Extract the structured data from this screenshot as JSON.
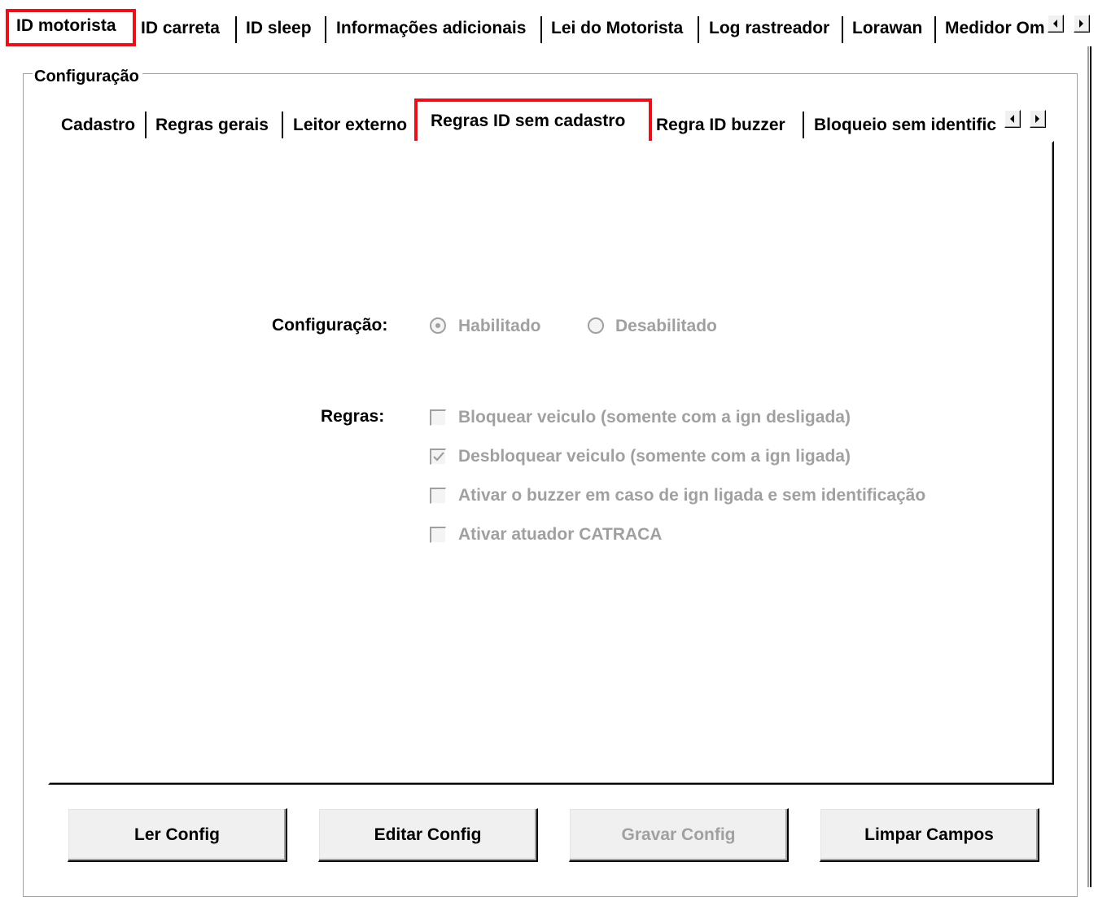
{
  "top_tabs": [
    {
      "label": "ID motorista"
    },
    {
      "label": "ID carreta"
    },
    {
      "label": "ID sleep"
    },
    {
      "label": "Informações adicionais"
    },
    {
      "label": "Lei do Motorista"
    },
    {
      "label": "Log rastreador"
    },
    {
      "label": "Lorawan"
    },
    {
      "label": "Medidor Om"
    }
  ],
  "group_title": "Configuração",
  "inner_tabs": [
    {
      "label": "Cadastro"
    },
    {
      "label": "Regras gerais"
    },
    {
      "label": "Leitor externo"
    },
    {
      "label": "Regras ID sem cadastro"
    },
    {
      "label": "Regra ID buzzer"
    },
    {
      "label": "Bloqueio sem identific"
    }
  ],
  "form": {
    "config_label": "Configuração:",
    "radio_enabled": "Habilitado",
    "radio_disabled": "Desabilitado",
    "radio_selected": "Habilitado",
    "rules_label": "Regras:",
    "rules": [
      {
        "label": "Bloquear veiculo (somente com a ign desligada)",
        "checked": false
      },
      {
        "label": "Desbloquear veiculo (somente com a ign ligada)",
        "checked": true
      },
      {
        "label": "Ativar o buzzer em caso de ign ligada e sem identificação",
        "checked": false
      },
      {
        "label": "Ativar atuador CATRACA",
        "checked": false
      }
    ]
  },
  "buttons": {
    "read": "Ler Config",
    "edit": "Editar Config",
    "save": "Gravar Config",
    "clear": "Limpar Campos"
  },
  "colors": {
    "highlight": "#e3131b",
    "disabled_text": "#a0a0a0"
  },
  "icons": [
    "arrow-left-icon",
    "arrow-right-icon",
    "radio-icon",
    "checkbox-icon",
    "checkmark-icon"
  ]
}
